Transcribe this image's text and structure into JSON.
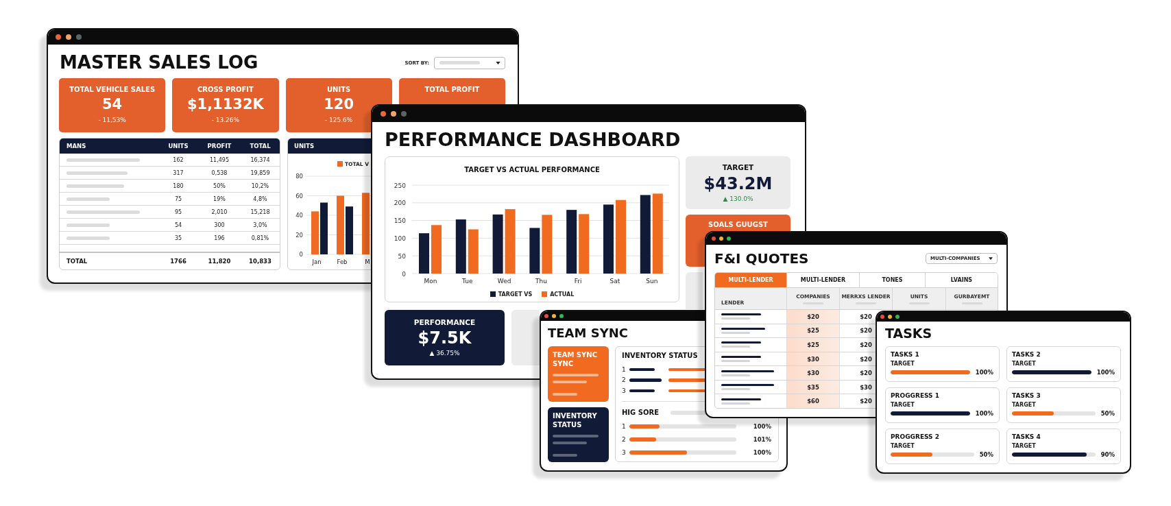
{
  "master_sales_log": {
    "title": "MASTER SALES LOG",
    "sort_by": {
      "label": "SORT BY:"
    },
    "stats": [
      {
        "label": "TOTAL VEHICLE SALES",
        "value": "54",
        "change": "- 11,53%"
      },
      {
        "label": "CROSS PROFIT",
        "value": "$1,1132K",
        "change": "- 13.26%"
      },
      {
        "label": "UNITS",
        "value": "120",
        "change": "- 125.6%"
      },
      {
        "label": "TOTAL PROFIT"
      }
    ],
    "table": {
      "columns": [
        "MANS",
        "UNITS",
        "PROFIT",
        "TOTAL"
      ],
      "rows": [
        [
          "",
          "162",
          "11,495",
          "16,374"
        ],
        [
          "",
          "317",
          "0,538",
          "19,859"
        ],
        [
          "",
          "180",
          "50%",
          "10,2%"
        ],
        [
          "",
          "75",
          "19%",
          "4,8%"
        ],
        [
          "",
          "95",
          "2,010",
          "15,218"
        ],
        [
          "",
          "54",
          "300",
          "3,0%"
        ],
        [
          "",
          "35",
          "196",
          "0,81%"
        ]
      ],
      "total": {
        "label": "TOTAL",
        "cells": [
          "1766",
          "11,820",
          "10,833"
        ]
      }
    },
    "units_panel": {
      "title": "UNITS",
      "chart_data": {
        "type": "bar",
        "categories": [
          "Jan",
          "Feb",
          "M"
        ],
        "series": [
          {
            "name": "TOTAL V",
            "color": "#ef6a22",
            "values": [
              44,
              60,
              63
            ]
          },
          {
            "color": "#111b38",
            "values": [
              53,
              49,
              null
            ]
          }
        ],
        "yticks": [
          0,
          20,
          40,
          60,
          80
        ],
        "ylim": [
          0,
          80
        ],
        "grid": true
      }
    }
  },
  "performance_dashboard": {
    "title": "PERFORMANCE DASHBOARD",
    "chart_panel": {
      "chart_data": {
        "type": "bar",
        "title": "TARGET VS ACTUAL PERFORMANCE",
        "categories": [
          "Mon",
          "Tue",
          "Wed",
          "Thu",
          "Fri",
          "Sat",
          "Sun"
        ],
        "series": [
          {
            "name": "TARGET VS",
            "color": "#111b38",
            "values": [
              114,
              153,
              167,
              129,
              180,
              195,
              222
            ]
          },
          {
            "name": "ACTUAL",
            "color": "#f06a1f",
            "values": [
              137,
              125,
              182,
              166,
              168,
              208,
              226
            ]
          }
        ],
        "yticks": [
          0,
          50,
          100,
          150,
          200,
          250
        ],
        "ylim": [
          0,
          250
        ],
        "grid": true
      }
    },
    "target_card": {
      "label": "TARGET",
      "value": "$43.2M",
      "change": "▲ 130.0%"
    },
    "goals_card": {
      "label": "SOALS GUUGST"
    },
    "performance_card": {
      "label": "PERFORMANCE",
      "value": "$7.5K",
      "change": "▲ 36.75%"
    }
  },
  "fi_quotes": {
    "title": "F&I QUOTES",
    "filter": {
      "value": "MULTI-COMPANIES"
    },
    "tabs": [
      {
        "label": "MULTI-LENDER",
        "selected": true
      },
      {
        "label": "MULTI-LENDER",
        "selected": false
      },
      {
        "label": "TONES",
        "selected": false
      },
      {
        "label": "LVAINS",
        "selected": false
      }
    ],
    "table": {
      "columns": [
        "LENDER",
        "COMPANIES",
        "MERRXS LENDER",
        "UNITS",
        "GURBAYEMT"
      ],
      "rows": [
        [
          "",
          "$20",
          "$20"
        ],
        [
          "",
          "$25",
          "$20"
        ],
        [
          "",
          "$25",
          "$20"
        ],
        [
          "",
          "$30",
          "$20"
        ],
        [
          "",
          "$30",
          "$20"
        ],
        [
          "",
          "$35",
          "$30"
        ],
        [
          "",
          "$60",
          "$20"
        ]
      ]
    }
  },
  "team_sync": {
    "title": "TEAM SYNC",
    "side_cards": [
      {
        "kind": "accent",
        "title": "TEAM SYNC SYNC"
      },
      {
        "kind": "dark",
        "title": "INVENTORY STATUS"
      }
    ],
    "inventory_status": {
      "title": "INVENTORY STATUS",
      "rows": [
        {
          "rank": "1"
        },
        {
          "rank": "2"
        },
        {
          "rank": "3"
        }
      ]
    },
    "high_score": {
      "title": "HIG SORE",
      "rows": [
        {
          "rank": "1",
          "level": 0.28,
          "reading": "100%"
        },
        {
          "rank": "2",
          "level": 0.25,
          "reading": "101%"
        },
        {
          "rank": "3",
          "level": 0.54,
          "reading": "100%"
        }
      ]
    }
  },
  "tasks": {
    "title": "TASKS",
    "items": [
      {
        "name": "TASKS 1",
        "label": "TARGET",
        "level": 1,
        "reading": "100%",
        "color": "#f06a1f"
      },
      {
        "name": "TASKS 2",
        "label": "TARGET",
        "level": 1,
        "reading": "100%",
        "color": "#111b38"
      },
      {
        "name": "PROGGRESS 1",
        "label": "TARGET",
        "level": 1,
        "reading": "100%",
        "color": "#111b38"
      },
      {
        "name": "TASKS 3",
        "label": "TARGET",
        "level": 0.5,
        "reading": "50%",
        "color": "#f06a1f"
      },
      {
        "name": "PROGGRESS 2",
        "label": "TARGET",
        "level": 0.5,
        "reading": "50%",
        "color": "#f06a1f"
      },
      {
        "name": "TASKS 4",
        "label": "TARGET",
        "level": 0.9,
        "reading": "90%",
        "color": "#111b38"
      }
    ]
  }
}
